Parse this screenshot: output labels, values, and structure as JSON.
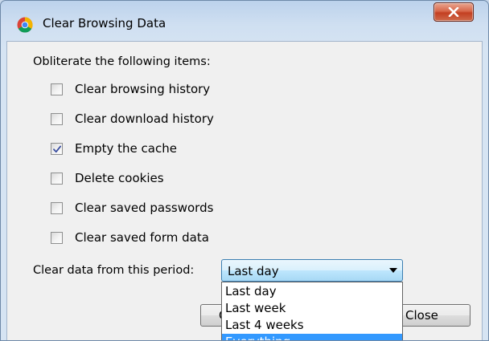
{
  "window": {
    "title": "Clear Browsing Data",
    "app_icon": "chrome-logo-icon",
    "close_icon": "close-x-icon"
  },
  "dialog": {
    "heading": "Obliterate the following items:",
    "checkboxes": [
      {
        "label": "Clear browsing history",
        "checked": false
      },
      {
        "label": "Clear download history",
        "checked": false
      },
      {
        "label": "Empty the cache",
        "checked": true
      },
      {
        "label": "Delete cookies",
        "checked": false
      },
      {
        "label": "Clear saved passwords",
        "checked": false
      },
      {
        "label": "Clear saved form data",
        "checked": false
      }
    ],
    "period_label": "Clear data from this period:",
    "period_select": {
      "value": "Last day",
      "options": [
        "Last day",
        "Last week",
        "Last 4 weeks",
        "Everything"
      ],
      "highlighted": "Everything"
    }
  },
  "buttons": {
    "left_visible_text": "C",
    "close_label": "Close"
  },
  "colors": {
    "close_button": "#c33f21",
    "dropdown_highlight": "#3399ff",
    "select_border": "#3c7fb1"
  }
}
